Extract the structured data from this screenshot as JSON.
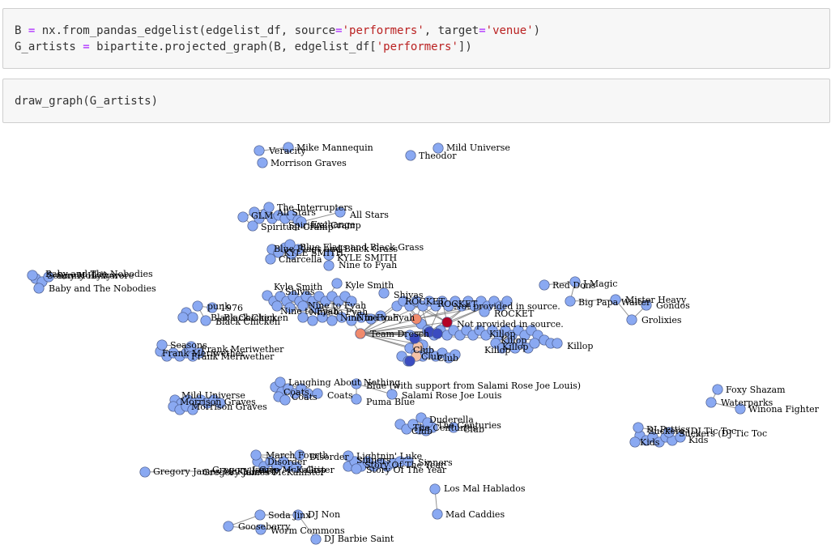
{
  "cells": [
    {
      "lines": [
        [
          {
            "t": "B ",
            "c": ""
          },
          {
            "t": "=",
            "c": "op"
          },
          {
            "t": " nx.from_pandas_edgelist(edgelist_df, source",
            "c": ""
          },
          {
            "t": "=",
            "c": "op"
          },
          {
            "t": "'performers'",
            "c": "str"
          },
          {
            "t": ", target",
            "c": ""
          },
          {
            "t": "=",
            "c": "op"
          },
          {
            "t": "'venue'",
            "c": "str"
          },
          {
            "t": ")",
            "c": ""
          }
        ],
        [
          {
            "t": "G_artists ",
            "c": ""
          },
          {
            "t": "=",
            "c": "op"
          },
          {
            "t": " bipartite.projected_graph(B, edgelist_df[",
            "c": ""
          },
          {
            "t": "'performers'",
            "c": "str"
          },
          {
            "t": "])",
            "c": ""
          }
        ]
      ]
    },
    {
      "lines": [
        [
          {
            "t": "draw_graph(G_artists)",
            "c": ""
          }
        ]
      ]
    }
  ],
  "colors": {
    "node_default": "#8aa9f2",
    "node_stroke": "#4a5a8a",
    "edge": "#777777",
    "hub_dark_red": "#b40426",
    "hub_salmon": "#f08a6c",
    "hub_peach": "#f4c2a8",
    "hub_navy": "#3b4cc0"
  },
  "graph": {
    "nodes": [
      {
        "label": "Mike Mannequin"
      },
      {
        "label": "Veracity"
      },
      {
        "label": "Morrison Graves"
      },
      {
        "label": "Mild Universe"
      },
      {
        "label": "Theodor"
      },
      {
        "label": "The Interrupters"
      },
      {
        "label": "All Stars"
      },
      {
        "label": "GLM"
      },
      {
        "label": "Exchange"
      },
      {
        "label": "Spiritual Cramp"
      },
      {
        "label": "Blue Flags and Black Grass"
      },
      {
        "label": "KYLE SMITH"
      },
      {
        "label": "Charcella"
      },
      {
        "label": "Nine to Fyah"
      },
      {
        "label": "Kyle Smith"
      },
      {
        "label": "Shivas"
      },
      {
        "label": "Not provided in source."
      },
      {
        "label": "ROCKET"
      },
      {
        "label": "Team Dresch"
      },
      {
        "label": "Baby and The Nobodies"
      },
      {
        "label": "Sonny Hollywore"
      },
      {
        "label": "Red Dons"
      },
      {
        "label": "J Magic"
      },
      {
        "label": "Big Papa Walter"
      },
      {
        "label": "Mister Heavy"
      },
      {
        "label": "Gondos"
      },
      {
        "label": "Grolixies"
      },
      {
        "label": "punk"
      },
      {
        "label": "1976"
      },
      {
        "label": "Black Chicken"
      },
      {
        "label": "Frank Meriwether"
      },
      {
        "label": "Seasons"
      },
      {
        "label": "Killop"
      },
      {
        "label": "Laughing About Nothing"
      },
      {
        "label": "Blue (with support from Salami Rose Joe Louis)"
      },
      {
        "label": "Salami Rose Joe Louis"
      },
      {
        "label": "Puma Blue"
      },
      {
        "label": "Coats"
      },
      {
        "label": "Foxy Shazam"
      },
      {
        "label": "Waterparks"
      },
      {
        "label": "Winona Fighter"
      },
      {
        "label": "Duderella"
      },
      {
        "label": "The Centuries"
      },
      {
        "label": "Club"
      },
      {
        "label": "DJ Pettiss"
      },
      {
        "label": "Suckers (DJ Tic Toc"
      },
      {
        "label": "Kids"
      },
      {
        "label": "March Fourth"
      },
      {
        "label": "Disorder"
      },
      {
        "label": "Grip"
      },
      {
        "label": "Lightnin' Luke"
      },
      {
        "label": "Sinners"
      },
      {
        "label": "Story Of The Year"
      },
      {
        "label": "Gregory James McKallister"
      },
      {
        "label": "Los Mal Hablados"
      },
      {
        "label": "Mad Caddies"
      },
      {
        "label": "Soda Jinx"
      },
      {
        "label": "DJ Non"
      },
      {
        "label": "Gooseberry"
      },
      {
        "label": "Worm Commons"
      },
      {
        "label": "DJ Barbie Saint"
      }
    ]
  }
}
